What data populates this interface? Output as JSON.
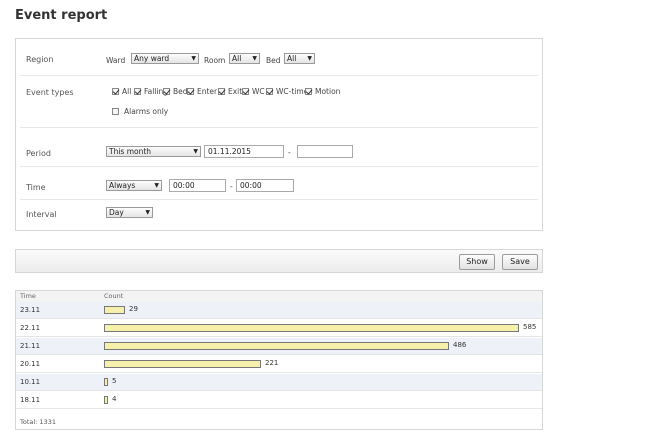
{
  "title": "Event report",
  "filters": {
    "region": {
      "label": "Region",
      "ward_label": "Ward",
      "ward_value": "Any ward",
      "room_label": "Room",
      "room_value": "All",
      "bed_label": "Bed",
      "bed_value": "All"
    },
    "event_types": {
      "label": "Event types",
      "items": [
        {
          "label": "All",
          "checked": true
        },
        {
          "label": "Falling",
          "checked": true
        },
        {
          "label": "Bed",
          "checked": true
        },
        {
          "label": "Enter",
          "checked": true
        },
        {
          "label": "Exit",
          "checked": true
        },
        {
          "label": "WC",
          "checked": true
        },
        {
          "label": "WC-time",
          "checked": true
        },
        {
          "label": "Motion",
          "checked": true
        }
      ],
      "alarms_only": {
        "label": "Alarms only",
        "checked": false
      }
    },
    "period": {
      "label": "Period",
      "value": "This month",
      "from": "01.11.2015",
      "dash": "-",
      "to": ""
    },
    "time": {
      "label": "Time",
      "value": "Always",
      "from": "00:00",
      "dash": "-",
      "to": "00:00"
    },
    "interval": {
      "label": "Interval",
      "value": "Day"
    }
  },
  "toolbar": {
    "show_label": "Show",
    "save_label": "Save"
  },
  "table": {
    "headers": {
      "time": "Time",
      "count": "Count"
    },
    "rows": [
      {
        "time": "23.11",
        "count": 29
      },
      {
        "time": "22.11",
        "count": 585
      },
      {
        "time": "21.11",
        "count": 486
      },
      {
        "time": "20.11",
        "count": 221
      },
      {
        "time": "10.11",
        "count": 5
      },
      {
        "time": "18.11",
        "count": 4
      }
    ],
    "total": "Total: 1331"
  },
  "colors": {
    "bar_fill": "#f7f0ad",
    "row_alt": "#eef1f7"
  }
}
